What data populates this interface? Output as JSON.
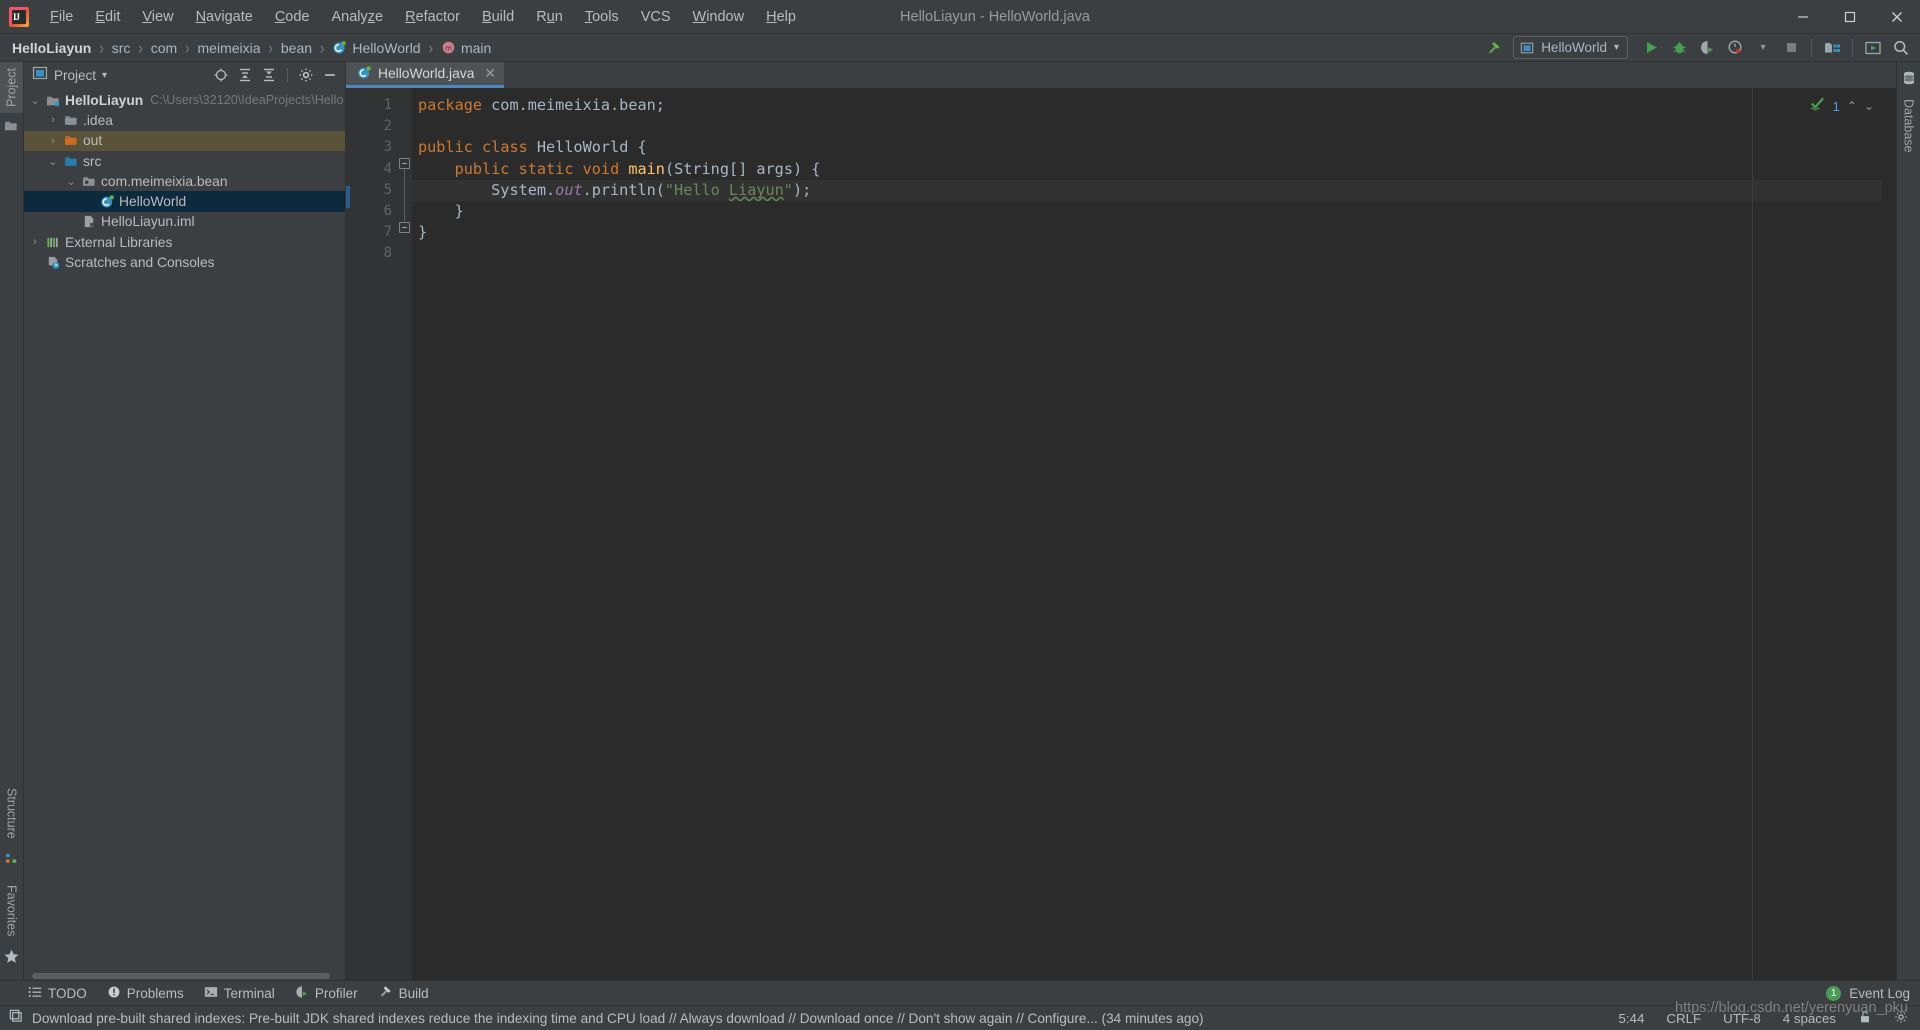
{
  "window": {
    "title": "HelloLiayun - HelloWorld.java",
    "app_icon": "intellij-idea-logo",
    "minimize": "—",
    "maximize": "▢",
    "close": "✕"
  },
  "menu": [
    {
      "label": "File",
      "mnemonic": "F"
    },
    {
      "label": "Edit",
      "mnemonic": "E"
    },
    {
      "label": "View",
      "mnemonic": "V"
    },
    {
      "label": "Navigate",
      "mnemonic": "N"
    },
    {
      "label": "Code",
      "mnemonic": "C"
    },
    {
      "label": "Analyze",
      "mnemonic": "z"
    },
    {
      "label": "Refactor",
      "mnemonic": "R"
    },
    {
      "label": "Build",
      "mnemonic": "B"
    },
    {
      "label": "Run",
      "mnemonic": "n"
    },
    {
      "label": "Tools",
      "mnemonic": "T"
    },
    {
      "label": "VCS",
      "mnemonic": ""
    },
    {
      "label": "Window",
      "mnemonic": "W"
    },
    {
      "label": "Help",
      "mnemonic": "H"
    }
  ],
  "breadcrumb": {
    "separator": "›",
    "items": [
      {
        "label": "HelloLiayun",
        "icon": "",
        "bold": true
      },
      {
        "label": "src",
        "icon": ""
      },
      {
        "label": "com",
        "icon": ""
      },
      {
        "label": "meimeixia",
        "icon": ""
      },
      {
        "label": "bean",
        "icon": ""
      },
      {
        "label": "HelloWorld",
        "icon": "java-class-icon"
      },
      {
        "label": "main",
        "icon": "method-icon"
      }
    ]
  },
  "toolbar": {
    "build_label": "Build",
    "run_config": "HelloWorld",
    "run_config_dropdown": "▾",
    "run_label": "Run",
    "debug_label": "Debug",
    "run_coverage_label": "Run with Coverage",
    "profiler_label": "Profiler",
    "stop_label": "Stop",
    "project_structure_label": "Project Structure",
    "updates_label": "Updates",
    "search_label": "Search Everywhere"
  },
  "project_panel": {
    "title": "Project",
    "title_dropdown": "▾",
    "buttons": {
      "locate": "select-opened-file",
      "expand": "expand-all",
      "collapse": "collapse-all",
      "settings": "settings",
      "hide": "hide"
    },
    "tree": [
      {
        "label": "HelloLiayun",
        "path": "C:\\Users\\32120\\IdeaProjects\\Hello",
        "arrow": "⌄",
        "icon": "module-icon",
        "indent": 0,
        "bold": true,
        "state": "normal"
      },
      {
        "label": ".idea",
        "path": "",
        "arrow": "›",
        "icon": "folder-icon",
        "indent": 1,
        "bold": false,
        "state": "normal"
      },
      {
        "label": "out",
        "path": "",
        "arrow": "›",
        "icon": "folder-orange-icon",
        "indent": 1,
        "bold": false,
        "state": "hovered"
      },
      {
        "label": "src",
        "path": "",
        "arrow": "⌄",
        "icon": "source-folder-icon",
        "indent": 1,
        "bold": false,
        "state": "normal"
      },
      {
        "label": "com.meimeixia.bean",
        "path": "",
        "arrow": "⌄",
        "icon": "package-icon",
        "indent": 2,
        "bold": false,
        "state": "normal"
      },
      {
        "label": "HelloWorld",
        "path": "",
        "arrow": "",
        "icon": "java-class-icon",
        "indent": 3,
        "bold": false,
        "state": "selected"
      },
      {
        "label": "HelloLiayun.iml",
        "path": "",
        "arrow": "",
        "icon": "iml-file-icon",
        "indent": 2,
        "bold": false,
        "state": "normal"
      },
      {
        "label": "External Libraries",
        "path": "",
        "arrow": "›",
        "icon": "libraries-icon",
        "indent": 0,
        "bold": false,
        "state": "normal"
      },
      {
        "label": "Scratches and Consoles",
        "path": "",
        "arrow": "",
        "icon": "scratches-icon",
        "indent": 0,
        "bold": false,
        "state": "normal"
      }
    ]
  },
  "left_strip": {
    "tabs": [
      {
        "label": "Project",
        "icon": "project-icon",
        "active": true
      },
      {
        "label": "Structure",
        "icon": "structure-icon",
        "active": false
      },
      {
        "label": "Favorites",
        "icon": "favorites-icon",
        "active": false
      }
    ]
  },
  "right_strip": {
    "tabs": [
      {
        "label": "Database",
        "icon": "database-icon",
        "active": false
      }
    ]
  },
  "editor": {
    "tab": {
      "label": "HelloWorld.java",
      "icon": "java-class-icon",
      "close": "✕"
    },
    "inspection": {
      "status_icon": "inspections-ok-icon",
      "count": "1",
      "up": "⌃",
      "down": "⌄"
    },
    "lines": [
      {
        "num": "1",
        "run_marker": false,
        "current": false
      },
      {
        "num": "2",
        "run_marker": false,
        "current": false
      },
      {
        "num": "3",
        "run_marker": true,
        "current": false
      },
      {
        "num": "4",
        "run_marker": true,
        "current": false
      },
      {
        "num": "5",
        "run_marker": false,
        "current": true
      },
      {
        "num": "6",
        "run_marker": false,
        "current": false
      },
      {
        "num": "7",
        "run_marker": false,
        "current": false
      },
      {
        "num": "8",
        "run_marker": false,
        "current": false
      }
    ],
    "code": {
      "l1_kw": "package",
      "l1_rest": " com.meimeixia.bean;",
      "l3_kw1": "public",
      "l3_kw2": "class",
      "l3_name": "HelloWorld",
      "l3_brace": "{",
      "l4_kw1": "public",
      "l4_kw2": "static",
      "l4_kw3": "void",
      "l4_name": "main",
      "l4_args": "(String[] args) {",
      "l5_sys": "System.",
      "l5_out": "out",
      "l5_println": ".println(",
      "l5_str_q1": "\"Hello ",
      "l5_str_typo": "Liayun",
      "l5_str_q2": "\"",
      "l5_end": ");",
      "l6_brace": "}",
      "l7_brace": "}"
    }
  },
  "bottom_tabs": [
    {
      "label": "TODO",
      "icon": "todo-icon"
    },
    {
      "label": "Problems",
      "icon": "problems-icon"
    },
    {
      "label": "Terminal",
      "icon": "terminal-icon"
    },
    {
      "label": "Profiler",
      "icon": "profiler-icon"
    },
    {
      "label": "Build",
      "icon": "build-icon"
    }
  ],
  "event_log": {
    "count": "1",
    "label": "Event Log"
  },
  "statusbar": {
    "message": "Download pre-built shared indexes: Pre-built JDK shared indexes reduce the indexing time and CPU load // Always download // Download once // Don't show again // Configure... (34 minutes ago)",
    "line_column": "5:44",
    "line_separator": "CRLF",
    "encoding": "UTF-8",
    "indent": "4 spaces",
    "lock_icon": "unlock-icon",
    "gear_icon": "gear-icon"
  },
  "watermark": "https://blog.csdn.net/yerenyuan_pku",
  "colors": {
    "bg": "#3c3f41",
    "editor_bg": "#2b2b2b",
    "accent_blue": "#4a88c7",
    "selection": "#0d293e",
    "keyword": "#cc7832",
    "string": "#6a8759",
    "method": "#ffc66d",
    "field": "#9876aa",
    "text": "#a9b7c6",
    "green": "#499c54"
  }
}
